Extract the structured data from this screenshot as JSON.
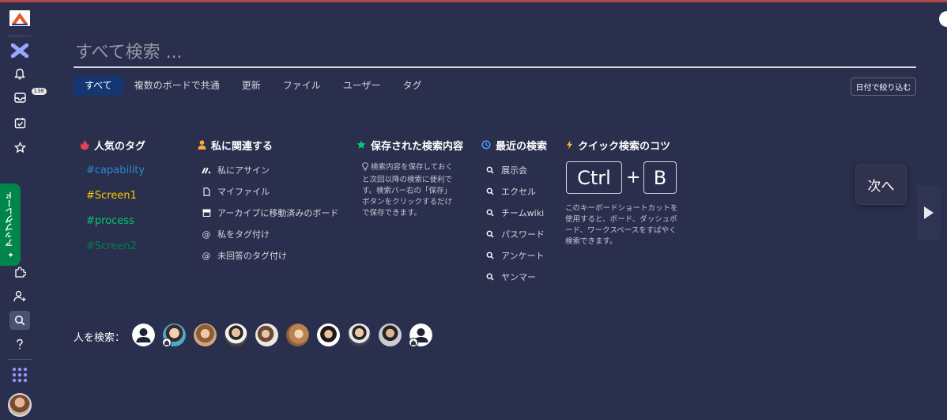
{
  "search": {
    "placeholder": "すべて検索 ..."
  },
  "tabs": [
    {
      "label": "すべて",
      "active": true
    },
    {
      "label": "複数のボードで共通",
      "active": false
    },
    {
      "label": "更新",
      "active": false
    },
    {
      "label": "ファイル",
      "active": false
    },
    {
      "label": "ユーザー",
      "active": false
    },
    {
      "label": "タグ",
      "active": false
    }
  ],
  "date_filter_label": "日付で絞り込む",
  "sidebar": {
    "inbox_badge": "138",
    "upgrade_label": "✦ アップグレード",
    "icons": [
      "notification-bell-icon",
      "inbox-icon",
      "my-work-icon",
      "favorites-star-icon",
      "apps-puzzle-icon",
      "invite-user-icon",
      "search-icon",
      "help-icon",
      "product-switcher-icon"
    ]
  },
  "popular_tags": {
    "title": "人気のタグ",
    "items": [
      {
        "label": "#capability",
        "color": "#2e8ad1"
      },
      {
        "label": "#Screen1",
        "color": "#ffcb00"
      },
      {
        "label": "#process",
        "color": "#00c875"
      },
      {
        "label": "#Screen2",
        "color": "#037f4c"
      }
    ]
  },
  "related": {
    "title": "私に関連する",
    "items": [
      {
        "label": "私にアサイン",
        "icon": "monday-logo-icon"
      },
      {
        "label": "マイファイル",
        "icon": "file-icon"
      },
      {
        "label": "アーカイブに移動済みのボード",
        "icon": "archive-icon"
      },
      {
        "label": "私をタグ付け",
        "icon": "at-icon"
      },
      {
        "label": "未回答のタグ付け",
        "icon": "at-icon"
      }
    ]
  },
  "saved": {
    "title": "保存された検索内容",
    "description": "検索内容を保存しておくと次回以降の検索に便利です。検索バー右の「保存」ボタンをクリックするだけで保存できます。"
  },
  "recent": {
    "title": "最近の検索",
    "items": [
      "展示会",
      "エクセル",
      "チームwiki",
      "パスワード",
      "アンケート",
      "ヤンマー"
    ]
  },
  "tips": {
    "title": "クイック検索のコツ",
    "key1": "Ctrl",
    "plus": "+",
    "key2": "B",
    "description": "このキーボードショートカットを使用すると、ボード、ダッシュボード、ワークスペースをすばやく検索できます。",
    "next_label": "次へ"
  },
  "people": {
    "label": "人を検索："
  },
  "colors": {
    "background": "#292f4c",
    "active_tab": "#133774",
    "upgrade": "#00854d"
  }
}
